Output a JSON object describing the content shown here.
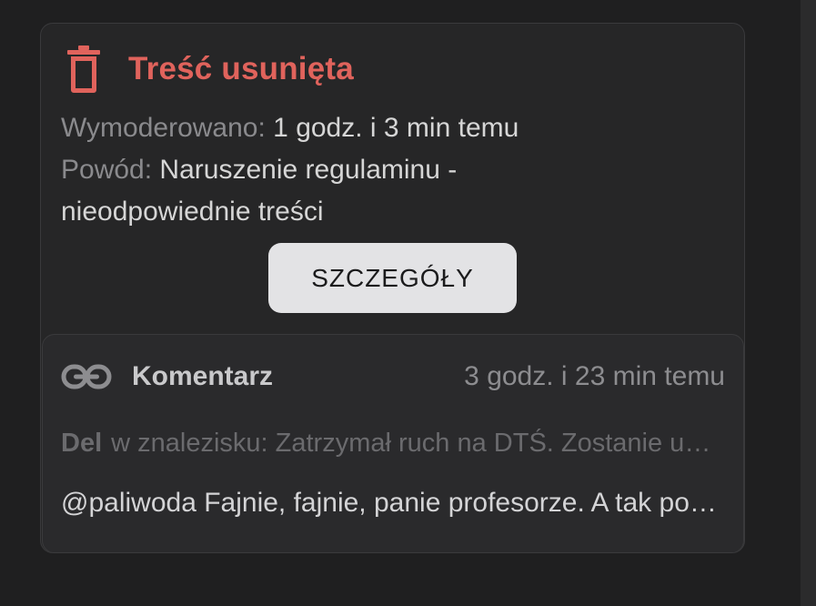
{
  "moderation": {
    "title": "Treść usunięta",
    "moderated_label": "Wymoderowano:",
    "moderated_value": "1 godz. i 3 min temu",
    "reason_label": "Powód:",
    "reason_value": "Naruszenie regulaminu - nieodpowiednie treści",
    "details_button": "SZCZEGÓŁY",
    "icon": "trash-icon"
  },
  "comment": {
    "icon": "link-icon",
    "type": "Komentarz",
    "time": "3 godz. i 23 min temu",
    "author": "Del",
    "context": "w znalezisku: Zatrzymał ruch na DTŚ. Zostanie ukarany",
    "text": "@paliwoda Fajnie, fajnie, panie profesorze. A tak poważnie"
  },
  "colors": {
    "background": "#1f1f20",
    "card": "#262627",
    "accent_red": "#e0635c",
    "button": "#e3e3e5"
  }
}
